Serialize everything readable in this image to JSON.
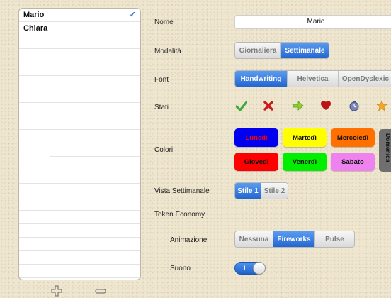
{
  "users": {
    "items": [
      "Mario",
      "Chiara"
    ],
    "selected_check": "✓"
  },
  "toolbar": {
    "add_icon": "plus-outline-icon",
    "delete_icon": "minus-outline-icon"
  },
  "form": {
    "name_label": "Nome",
    "name_value": "Mario",
    "mode_label": "Modalità",
    "mode_options": [
      "Giornaliera",
      "Settimanale"
    ],
    "mode_selected": "Settimanale",
    "font_label": "Font",
    "font_options": [
      "Handwriting",
      "Helvetica",
      "OpenDyslexic"
    ],
    "font_selected": "Handwriting",
    "states_label": "Stati",
    "states_icons": [
      "check-icon",
      "cross-icon",
      "arrow-right-icon",
      "heart-icon",
      "clock-icon",
      "star-icon"
    ],
    "colors_label": "Colori",
    "days": {
      "monday": "Lunedì",
      "tuesday": "Martedì",
      "wednesday": "Mercoledì",
      "thursday": "Giovedì",
      "friday": "Venerdì",
      "saturday": "Sabato",
      "sunday": "Domenica"
    },
    "day_colors": {
      "monday": "#0000ee",
      "tuesday": "#ffff00",
      "wednesday": "#ff7000",
      "thursday": "#ff0000",
      "friday": "#00ee00",
      "saturday": "#ee82ee",
      "sunday": "#6f6f6f"
    },
    "weekly_view_label": "Vista Settimanale",
    "weekly_view_options": [
      "Stile 1",
      "Stile 2"
    ],
    "weekly_view_selected": "Stile 1",
    "token_label": "Token Economy",
    "animation_label": "Animazione",
    "animation_options": [
      "Nessuna",
      "Fireworks",
      "Pulse"
    ],
    "animation_selected": "Fireworks",
    "sound_label": "Suono",
    "sound_on_text": "I",
    "sound_on": true
  }
}
